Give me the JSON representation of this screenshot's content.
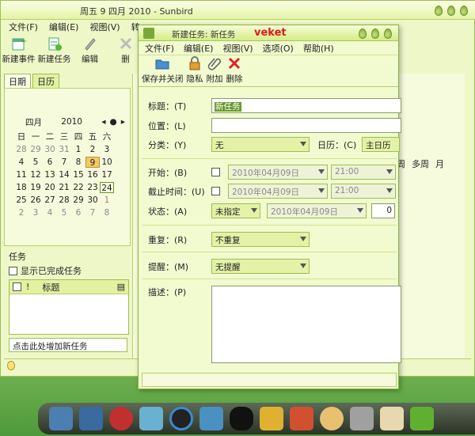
{
  "main_window": {
    "title": "周五 9 四月 2010 - Sunbird",
    "menu": [
      "文件(F)",
      "编辑(E)",
      "视图(V)",
      "转"
    ],
    "toolbar": [
      {
        "label": "新建事件",
        "icon": "new-event-icon"
      },
      {
        "label": "新建任务",
        "icon": "new-task-icon"
      },
      {
        "label": "编辑",
        "icon": "edit-icon"
      },
      {
        "label": "删",
        "icon": "delete-icon"
      }
    ],
    "tabs": [
      "日期",
      "日历"
    ],
    "calendar": {
      "month": "四月",
      "year": "2010",
      "weekdays": [
        "日",
        "一",
        "二",
        "三",
        "四",
        "五",
        "六"
      ],
      "days": [
        [
          "28",
          "29",
          "30",
          "31",
          "1",
          "2",
          "3"
        ],
        [
          "4",
          "5",
          "6",
          "7",
          "8",
          "9",
          "10"
        ],
        [
          "11",
          "12",
          "13",
          "14",
          "15",
          "16",
          "17"
        ],
        [
          "18",
          "19",
          "20",
          "21",
          "22",
          "23",
          "24"
        ],
        [
          "25",
          "26",
          "27",
          "28",
          "29",
          "30",
          "1"
        ],
        [
          "2",
          "3",
          "4",
          "5",
          "6",
          "7",
          "8"
        ]
      ]
    },
    "tasks_label": "任务",
    "show_completed": "显示已完成任务",
    "task_title_col": "标题",
    "add_task_placeholder": "点击此处增加新任务",
    "view_tabs": [
      "周",
      "多周",
      "月"
    ]
  },
  "dialog": {
    "title": "新建任务: 新任务",
    "watermark": "veket",
    "menu": [
      "文件(F)",
      "编辑(E)",
      "视图(V)",
      "选项(O)",
      "帮助(H)"
    ],
    "toolbar": [
      {
        "label": "保存并关闭",
        "icon": "save-close-icon"
      },
      {
        "label": "隐私",
        "icon": "lock-icon"
      },
      {
        "label": "附加",
        "icon": "paperclip-icon"
      },
      {
        "label": "删除",
        "icon": "delete-x-icon"
      }
    ],
    "form": {
      "title_label": "标题：(T)",
      "title_value": "新任务",
      "location_label": "位置：(L)",
      "category_label": "分类：(Y)",
      "category_value": "无",
      "calendar_label": "日历：(C)",
      "calendar_value": "主日历",
      "start_label": "开始：(B)",
      "start_date": "2010年04月09日",
      "start_time": "21:00",
      "due_label": "截止时间：(U)",
      "due_date": "2010年04月09日",
      "due_time": "21:00",
      "status_label": "状态：(A)",
      "status_value": "未指定",
      "status_date": "2010年04月09日",
      "status_percent": "0",
      "repeat_label": "重复：(R)",
      "repeat_value": "不重复",
      "reminder_label": "提醒：(M)",
      "reminder_value": "无提醒",
      "description_label": "描述：(P)"
    }
  }
}
